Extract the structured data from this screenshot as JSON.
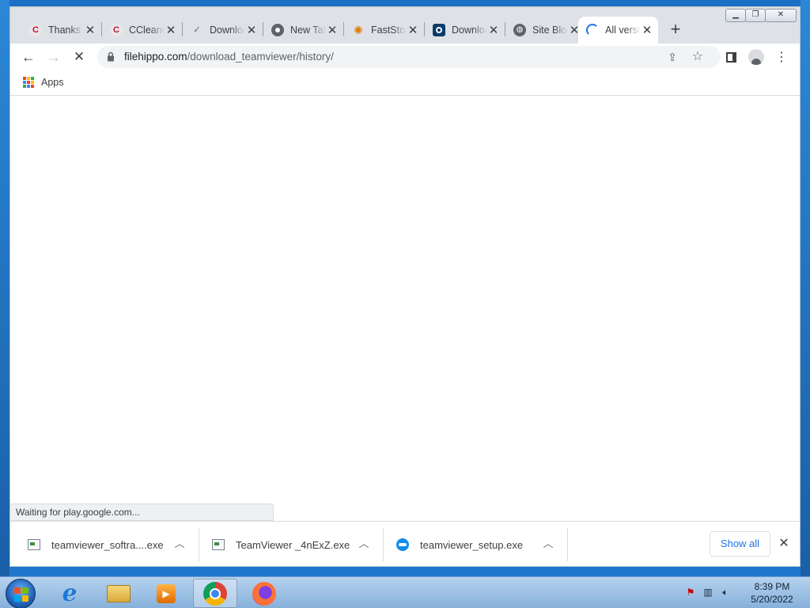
{
  "browser": {
    "tabs": [
      {
        "title": "Thanks",
        "favicon": "ccleaner-icon"
      },
      {
        "title": "CCleaner",
        "favicon": "ccleaner-icon"
      },
      {
        "title": "Download",
        "favicon": "doc-check-icon"
      },
      {
        "title": "New Tab",
        "favicon": "chrome-icon"
      },
      {
        "title": "FastStone",
        "favicon": "faststone-icon"
      },
      {
        "title": "Download",
        "favicon": "box-icon"
      },
      {
        "title": "Site Blocked",
        "favicon": "globe-icon"
      },
      {
        "title": "All versions",
        "favicon": "loading-icon"
      }
    ],
    "active_tab_index": 7,
    "new_tab_label": "+",
    "address": {
      "host": "filehippo.com",
      "path": "/download_teamviewer/history/"
    },
    "bookmarks": {
      "apps_label": "Apps"
    },
    "status_text": "Waiting for play.google.com...",
    "downloads": [
      {
        "name": "teamviewer_softra....exe",
        "icon": "exe-icon"
      },
      {
        "name": "TeamViewer _4nExZ.exe",
        "icon": "exe-icon"
      },
      {
        "name": "teamviewer_setup.exe",
        "icon": "teamviewer-icon"
      }
    ],
    "show_all_label": "Show all"
  },
  "taskbar": {
    "apps": [
      "internet-explorer-icon",
      "file-explorer-icon",
      "media-player-icon",
      "chrome-icon",
      "firefox-icon"
    ],
    "clock_time": "8:39 PM",
    "clock_date": "5/20/2022"
  },
  "colors": {
    "accent": "#1a73e8",
    "titlebar": "#dee1e6",
    "omnibox": "#f1f3f4"
  }
}
